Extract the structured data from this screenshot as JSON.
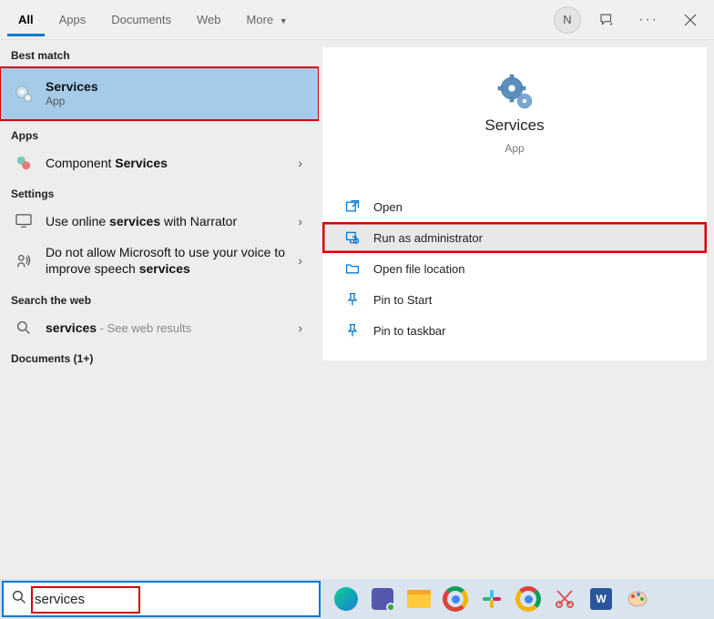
{
  "topbar": {
    "tabs": [
      "All",
      "Apps",
      "Documents",
      "Web",
      "More"
    ],
    "avatar_letter": "N"
  },
  "left": {
    "best_match_label": "Best match",
    "best_match": {
      "title": "Services",
      "subtitle": "App"
    },
    "apps_label": "Apps",
    "apps_item_prefix": "Component ",
    "apps_item_bold": "Services",
    "settings_label": "Settings",
    "setting1_prefix": "Use online ",
    "setting1_bold": "services",
    "setting1_suffix": " with Narrator",
    "setting2_prefix": "Do not allow Microsoft to use your voice to improve speech ",
    "setting2_bold": "services",
    "web_label": "Search the web",
    "web_bold": "services",
    "web_suffix": " - See web results",
    "documents_label": "Documents (1+)"
  },
  "preview": {
    "title": "Services",
    "subtitle": "App",
    "actions": {
      "open": "Open",
      "run_admin": "Run as administrator",
      "open_loc": "Open file location",
      "pin_start": "Pin to Start",
      "pin_taskbar": "Pin to taskbar"
    }
  },
  "search": {
    "value": "services"
  }
}
